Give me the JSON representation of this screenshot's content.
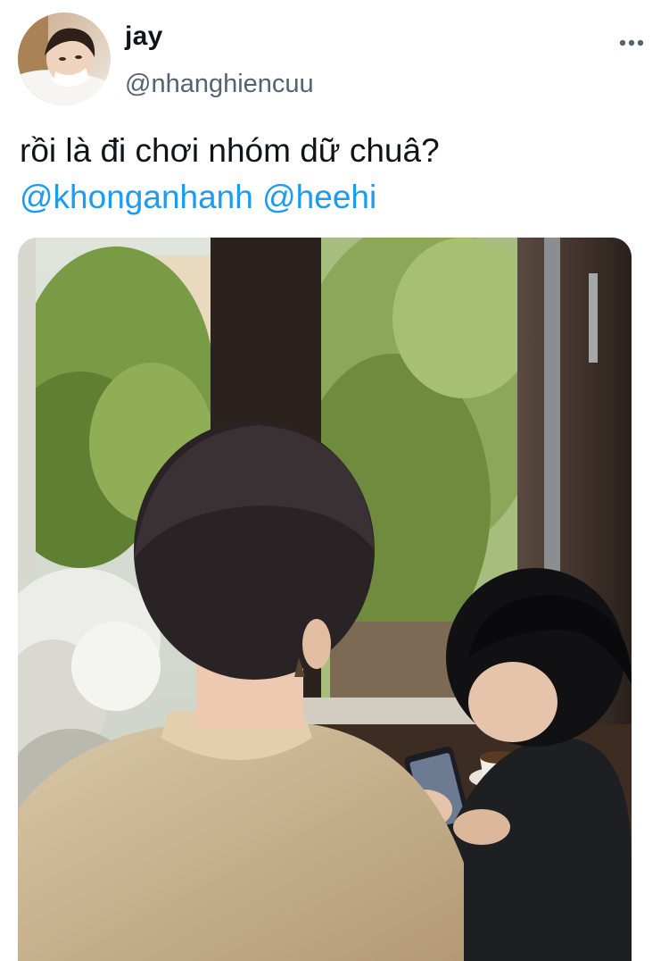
{
  "author": {
    "display_name": "jay",
    "handle": "@nhanghiencuu"
  },
  "tweet": {
    "text_line1": "rồi là đi chơi nhóm dữ chuâ?",
    "mentions": [
      "@khonganhanh",
      "@heehi"
    ]
  },
  "icons": {
    "more": "more-horizontal-icon"
  },
  "colors": {
    "mention": "#1d9bf0",
    "handle": "#536471",
    "text": "#0f1419"
  }
}
